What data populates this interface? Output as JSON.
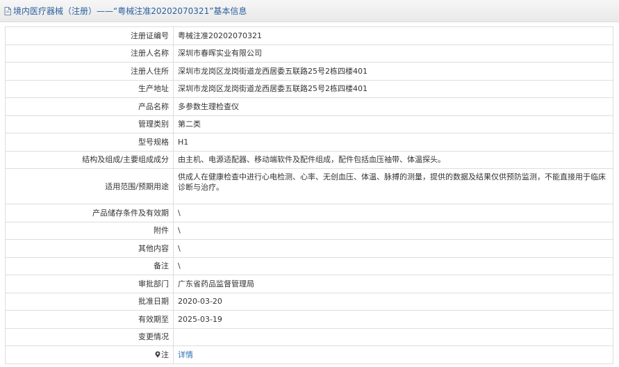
{
  "header": {
    "title": "境内医疗器械（注册）——“粤械注准20202070321”基本信息"
  },
  "fields": [
    {
      "label": "注册证编号",
      "value": "粤械注准20202070321"
    },
    {
      "label": "注册人名称",
      "value": "深圳市春晖实业有限公司"
    },
    {
      "label": "注册人住所",
      "value": "深圳市龙岗区龙岗街道龙西居委五联路25号2栋四楼401"
    },
    {
      "label": "生产地址",
      "value": "深圳市龙岗区龙岗街道龙西居委五联路25号2栋四楼401"
    },
    {
      "label": "产品名称",
      "value": "多参数生理检查仪"
    },
    {
      "label": "管理类别",
      "value": "第二类"
    },
    {
      "label": "型号规格",
      "value": "H1"
    },
    {
      "label": "结构及组成/主要组成成分",
      "value": "由主机、电源适配器、移动端软件及配件组成，配件包括血压袖带、体温探头。"
    },
    {
      "label": "适用范围/预期用途",
      "value": "供成人在健康检查中进行心电检测、心率、无创血压、体温、脉搏的测量，提供的数据及结果仅供预防监测，不能直接用于临床诊断与治疗。"
    },
    {
      "label": "产品储存条件及有效期",
      "value": "\\"
    },
    {
      "label": "附件",
      "value": "\\"
    },
    {
      "label": "其他内容",
      "value": "\\"
    },
    {
      "label": "备注",
      "value": "\\"
    },
    {
      "label": "审批部门",
      "value": "广东省药品监督管理局"
    },
    {
      "label": "批准日期",
      "value": "2020-03-20"
    },
    {
      "label": "有效期至",
      "value": "2025-03-19"
    },
    {
      "label": "变更情况",
      "value": ""
    }
  ],
  "note": {
    "label": "注",
    "link": "详情"
  },
  "icons": {
    "header": "document-icon",
    "note": "pin-icon"
  },
  "colors": {
    "title": "#2c5f9e",
    "link": "#2c6db5",
    "border": "#dddddd"
  }
}
